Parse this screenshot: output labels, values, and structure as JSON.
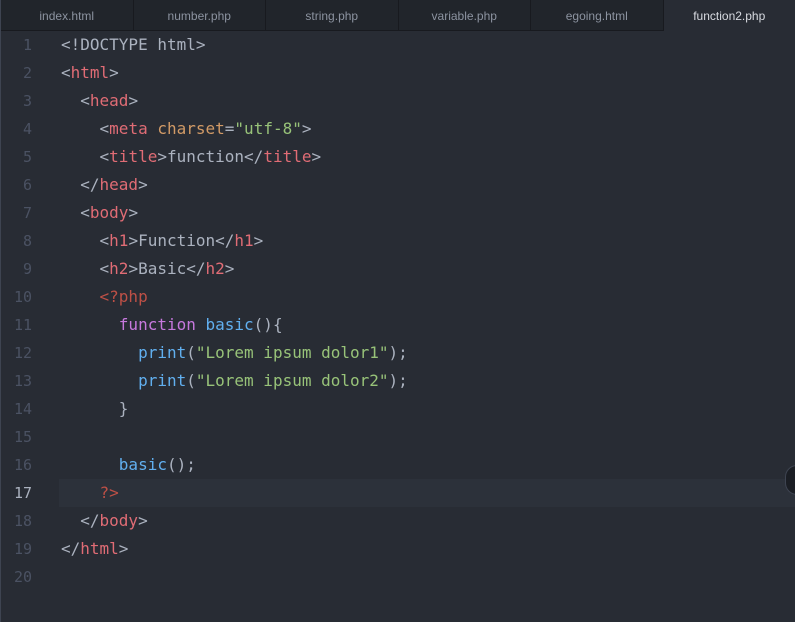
{
  "tabs": [
    {
      "label": "index.html"
    },
    {
      "label": "number.php"
    },
    {
      "label": "string.php"
    },
    {
      "label": "variable.php"
    },
    {
      "label": "egoing.html"
    },
    {
      "label": "function2.php"
    }
  ],
  "active_tab": "function2.php",
  "current_line": 17,
  "lines": [
    {
      "n": "1",
      "tokens": [
        [
          "plain",
          "<!DOCTYPE html>"
        ]
      ]
    },
    {
      "n": "2",
      "tokens": [
        [
          "plain",
          "<"
        ],
        [
          "tag",
          "html"
        ],
        [
          "plain",
          ">"
        ]
      ]
    },
    {
      "n": "3",
      "tokens": [
        [
          "plain",
          "  <"
        ],
        [
          "tag",
          "head"
        ],
        [
          "plain",
          ">"
        ]
      ]
    },
    {
      "n": "4",
      "tokens": [
        [
          "plain",
          "    <"
        ],
        [
          "tag",
          "meta"
        ],
        [
          "plain",
          " "
        ],
        [
          "attr",
          "charset"
        ],
        [
          "plain",
          "="
        ],
        [
          "str",
          "\"utf-8\""
        ],
        [
          "plain",
          ">"
        ]
      ]
    },
    {
      "n": "5",
      "tokens": [
        [
          "plain",
          "    <"
        ],
        [
          "tag",
          "title"
        ],
        [
          "plain",
          ">function</"
        ],
        [
          "tag",
          "title"
        ],
        [
          "plain",
          ">"
        ]
      ]
    },
    {
      "n": "6",
      "tokens": [
        [
          "plain",
          "  </"
        ],
        [
          "tag",
          "head"
        ],
        [
          "plain",
          ">"
        ]
      ]
    },
    {
      "n": "7",
      "tokens": [
        [
          "plain",
          "  <"
        ],
        [
          "tag",
          "body"
        ],
        [
          "plain",
          ">"
        ]
      ]
    },
    {
      "n": "8",
      "tokens": [
        [
          "plain",
          "    <"
        ],
        [
          "tag",
          "h1"
        ],
        [
          "plain",
          ">Function</"
        ],
        [
          "tag",
          "h1"
        ],
        [
          "plain",
          ">"
        ]
      ]
    },
    {
      "n": "9",
      "tokens": [
        [
          "plain",
          "    <"
        ],
        [
          "tag",
          "h2"
        ],
        [
          "plain",
          ">Basic</"
        ],
        [
          "tag",
          "h2"
        ],
        [
          "plain",
          ">"
        ]
      ]
    },
    {
      "n": "10",
      "tokens": [
        [
          "php",
          "    <?php"
        ]
      ]
    },
    {
      "n": "11",
      "tokens": [
        [
          "plain",
          "      "
        ],
        [
          "kw",
          "function"
        ],
        [
          "plain",
          " "
        ],
        [
          "fn",
          "basic"
        ],
        [
          "plain",
          "(){"
        ]
      ]
    },
    {
      "n": "12",
      "tokens": [
        [
          "plain",
          "        "
        ],
        [
          "fn",
          "print"
        ],
        [
          "plain",
          "("
        ],
        [
          "str",
          "\"Lorem ipsum dolor1\""
        ],
        [
          "plain",
          ");"
        ]
      ]
    },
    {
      "n": "13",
      "tokens": [
        [
          "plain",
          "        "
        ],
        [
          "fn",
          "print"
        ],
        [
          "plain",
          "("
        ],
        [
          "str",
          "\"Lorem ipsum dolor2\""
        ],
        [
          "plain",
          ");"
        ]
      ]
    },
    {
      "n": "14",
      "tokens": [
        [
          "plain",
          "      }"
        ]
      ]
    },
    {
      "n": "15",
      "tokens": []
    },
    {
      "n": "16",
      "tokens": [
        [
          "plain",
          "      "
        ],
        [
          "fn",
          "basic"
        ],
        [
          "plain",
          "();"
        ]
      ]
    },
    {
      "n": "17",
      "tokens": [
        [
          "php",
          "    ?>"
        ]
      ]
    },
    {
      "n": "18",
      "tokens": [
        [
          "plain",
          "  </"
        ],
        [
          "tag",
          "body"
        ],
        [
          "plain",
          ">"
        ]
      ]
    },
    {
      "n": "19",
      "tokens": [
        [
          "plain",
          "</"
        ],
        [
          "tag",
          "html"
        ],
        [
          "plain",
          ">"
        ]
      ]
    },
    {
      "n": "20",
      "tokens": []
    }
  ]
}
